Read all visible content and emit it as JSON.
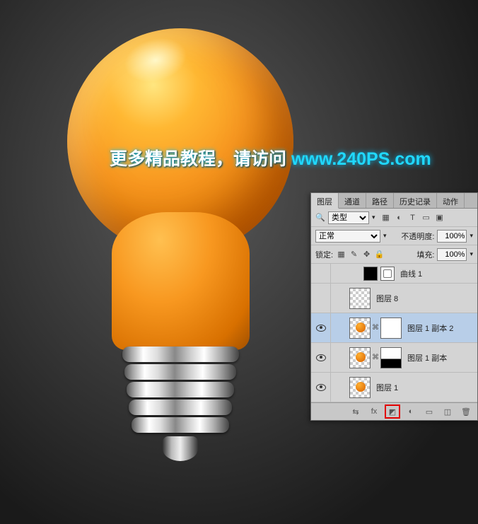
{
  "watermark": {
    "text_cn": "更多精品教程，请访问 ",
    "url": "www.240PS.com"
  },
  "panel": {
    "tabs": [
      "图层",
      "通道",
      "路径",
      "历史记录",
      "动作"
    ],
    "active_tab": 0,
    "type_label": "类型",
    "blend_mode": "正常",
    "opacity_label": "不透明度:",
    "opacity_value": "100%",
    "lock_label": "锁定:",
    "fill_label": "填充:",
    "fill_value": "100%",
    "layers": [
      {
        "name": "曲线 1",
        "visible": false,
        "kind": "adjustment-curves",
        "short": true
      },
      {
        "name": "图层 8",
        "visible": false,
        "kind": "pixel",
        "short": false
      },
      {
        "name": "图层 1 副本 2",
        "visible": true,
        "kind": "bulb-mask-white",
        "selected": true,
        "link": true
      },
      {
        "name": "图层 1 副本",
        "visible": true,
        "kind": "bulb-mask-half",
        "link": true
      },
      {
        "name": "图层 1",
        "visible": true,
        "kind": "bulb"
      }
    ],
    "footer_icons": [
      "link",
      "fx",
      "mask",
      "adjust",
      "group",
      "new",
      "trash"
    ]
  }
}
